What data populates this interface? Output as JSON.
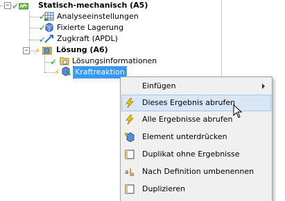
{
  "tree": {
    "root": {
      "label": "Statisch-mechanisch (A5)",
      "icon": "analysis-icon"
    },
    "children": [
      {
        "label": "Analyseeinstellungen",
        "icon": "settings-grid-icon"
      },
      {
        "label": "Fixierte Lagerung",
        "icon": "fixed-support-icon"
      },
      {
        "label": "Zugkraft (APDL)",
        "icon": "force-icon"
      }
    ],
    "solution": {
      "label": "Lösung (A6)",
      "icon": "solution-icon"
    },
    "solution_children": [
      {
        "label": "Lösungsinformationen",
        "icon": "solution-info-icon"
      },
      {
        "label": "Kraftreaktion",
        "icon": "force-reaction-icon"
      }
    ]
  },
  "context_menu": {
    "items": [
      {
        "label": "Einfügen",
        "icon": "",
        "submenu": true
      },
      {
        "label": "Dieses Ergebnis abrufen",
        "icon": "lightning-icon",
        "highlighted": true
      },
      {
        "label": "Alle Ergebnisse abrufen",
        "icon": "lightning-icon"
      },
      {
        "label": "Element unterdrücken",
        "icon": "suppress-icon"
      },
      {
        "label": "Duplikat ohne Ergebnisse",
        "icon": "duplicate-icon"
      },
      {
        "label": "Nach Definition umbenennen",
        "icon": "rename-icon"
      },
      {
        "label": "Duplizieren",
        "icon": "duplicate-icon"
      }
    ]
  },
  "colors": {
    "selection": "#3399ff",
    "menu_highlight": "#d8e6f6",
    "check": "#1aa31a",
    "lightning": "#e0b000"
  }
}
